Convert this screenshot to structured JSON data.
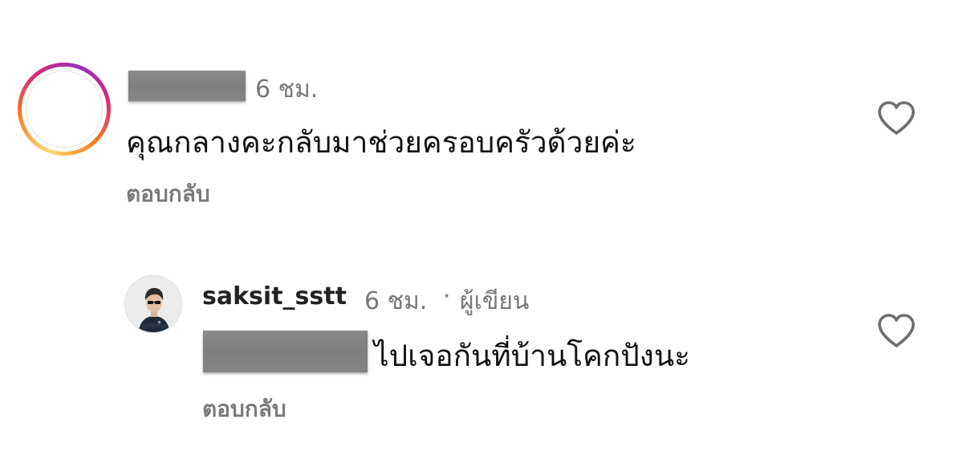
{
  "comments": [
    {
      "time": "6 ชม.",
      "text": "คุณกลางคะกลับมาช่วยครอบครัวด้วยค่ะ",
      "reply": "ตอบกลับ",
      "like_icon": "heart-outline-icon"
    },
    {
      "username": "saksit_sstt",
      "time": "6 ชม.",
      "separator": "·",
      "author_badge": "ผู้เขียน",
      "text": "ไปเจอกันที่บ้านโคกปังนะ",
      "reply": "ตอบกลับ",
      "like_icon": "heart-outline-icon"
    }
  ],
  "colors": {
    "meta": "#777777",
    "body": "#111111",
    "redaction": "#858585",
    "story_ring": [
      "#feda75",
      "#fa7e1e",
      "#d62976",
      "#962fbf"
    ]
  }
}
